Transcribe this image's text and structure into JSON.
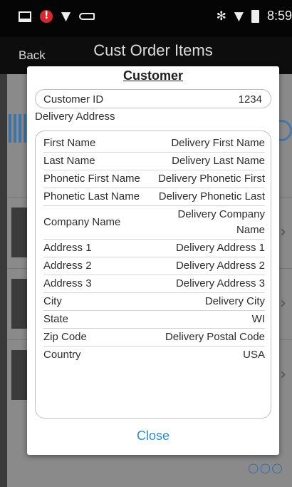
{
  "status_bar": {
    "time": "8:59",
    "icons": [
      "screenshot-icon",
      "alert-icon",
      "wifi-icon",
      "key-icon",
      "nfc-icon",
      "signal-icon",
      "battery-icon"
    ]
  },
  "app_bar": {
    "back_label": "Back",
    "title": "Cust Order Items"
  },
  "dialog": {
    "title": "Customer",
    "customer_id_label": "Customer ID",
    "customer_id_value": "1234",
    "delivery_address_label": "Delivery Address",
    "address_fields": [
      {
        "label": "First Name",
        "value": "Delivery First Name"
      },
      {
        "label": "Last Name",
        "value": "Delivery Last Name"
      },
      {
        "label": "Phonetic First Name",
        "value": "Delivery Phonetic First"
      },
      {
        "label": "Phonetic Last Name",
        "value": "Delivery Phonetic Last"
      },
      {
        "label": "Company Name",
        "value": "Delivery Company Name"
      },
      {
        "label": "Address 1",
        "value": "Delivery Address 1"
      },
      {
        "label": "Address 2",
        "value": "Delivery Address 2"
      },
      {
        "label": "Address 3",
        "value": "Delivery Address 3"
      },
      {
        "label": "City",
        "value": "Delivery City"
      },
      {
        "label": "State",
        "value": "WI"
      },
      {
        "label": "Zip Code",
        "value": "Delivery Postal Code"
      },
      {
        "label": "Country",
        "value": "USA"
      }
    ],
    "close_label": "Close"
  },
  "colors": {
    "accent": "#2d8bd1",
    "status_bar_bg": "#050505",
    "scrim": "#8a8a8a"
  }
}
